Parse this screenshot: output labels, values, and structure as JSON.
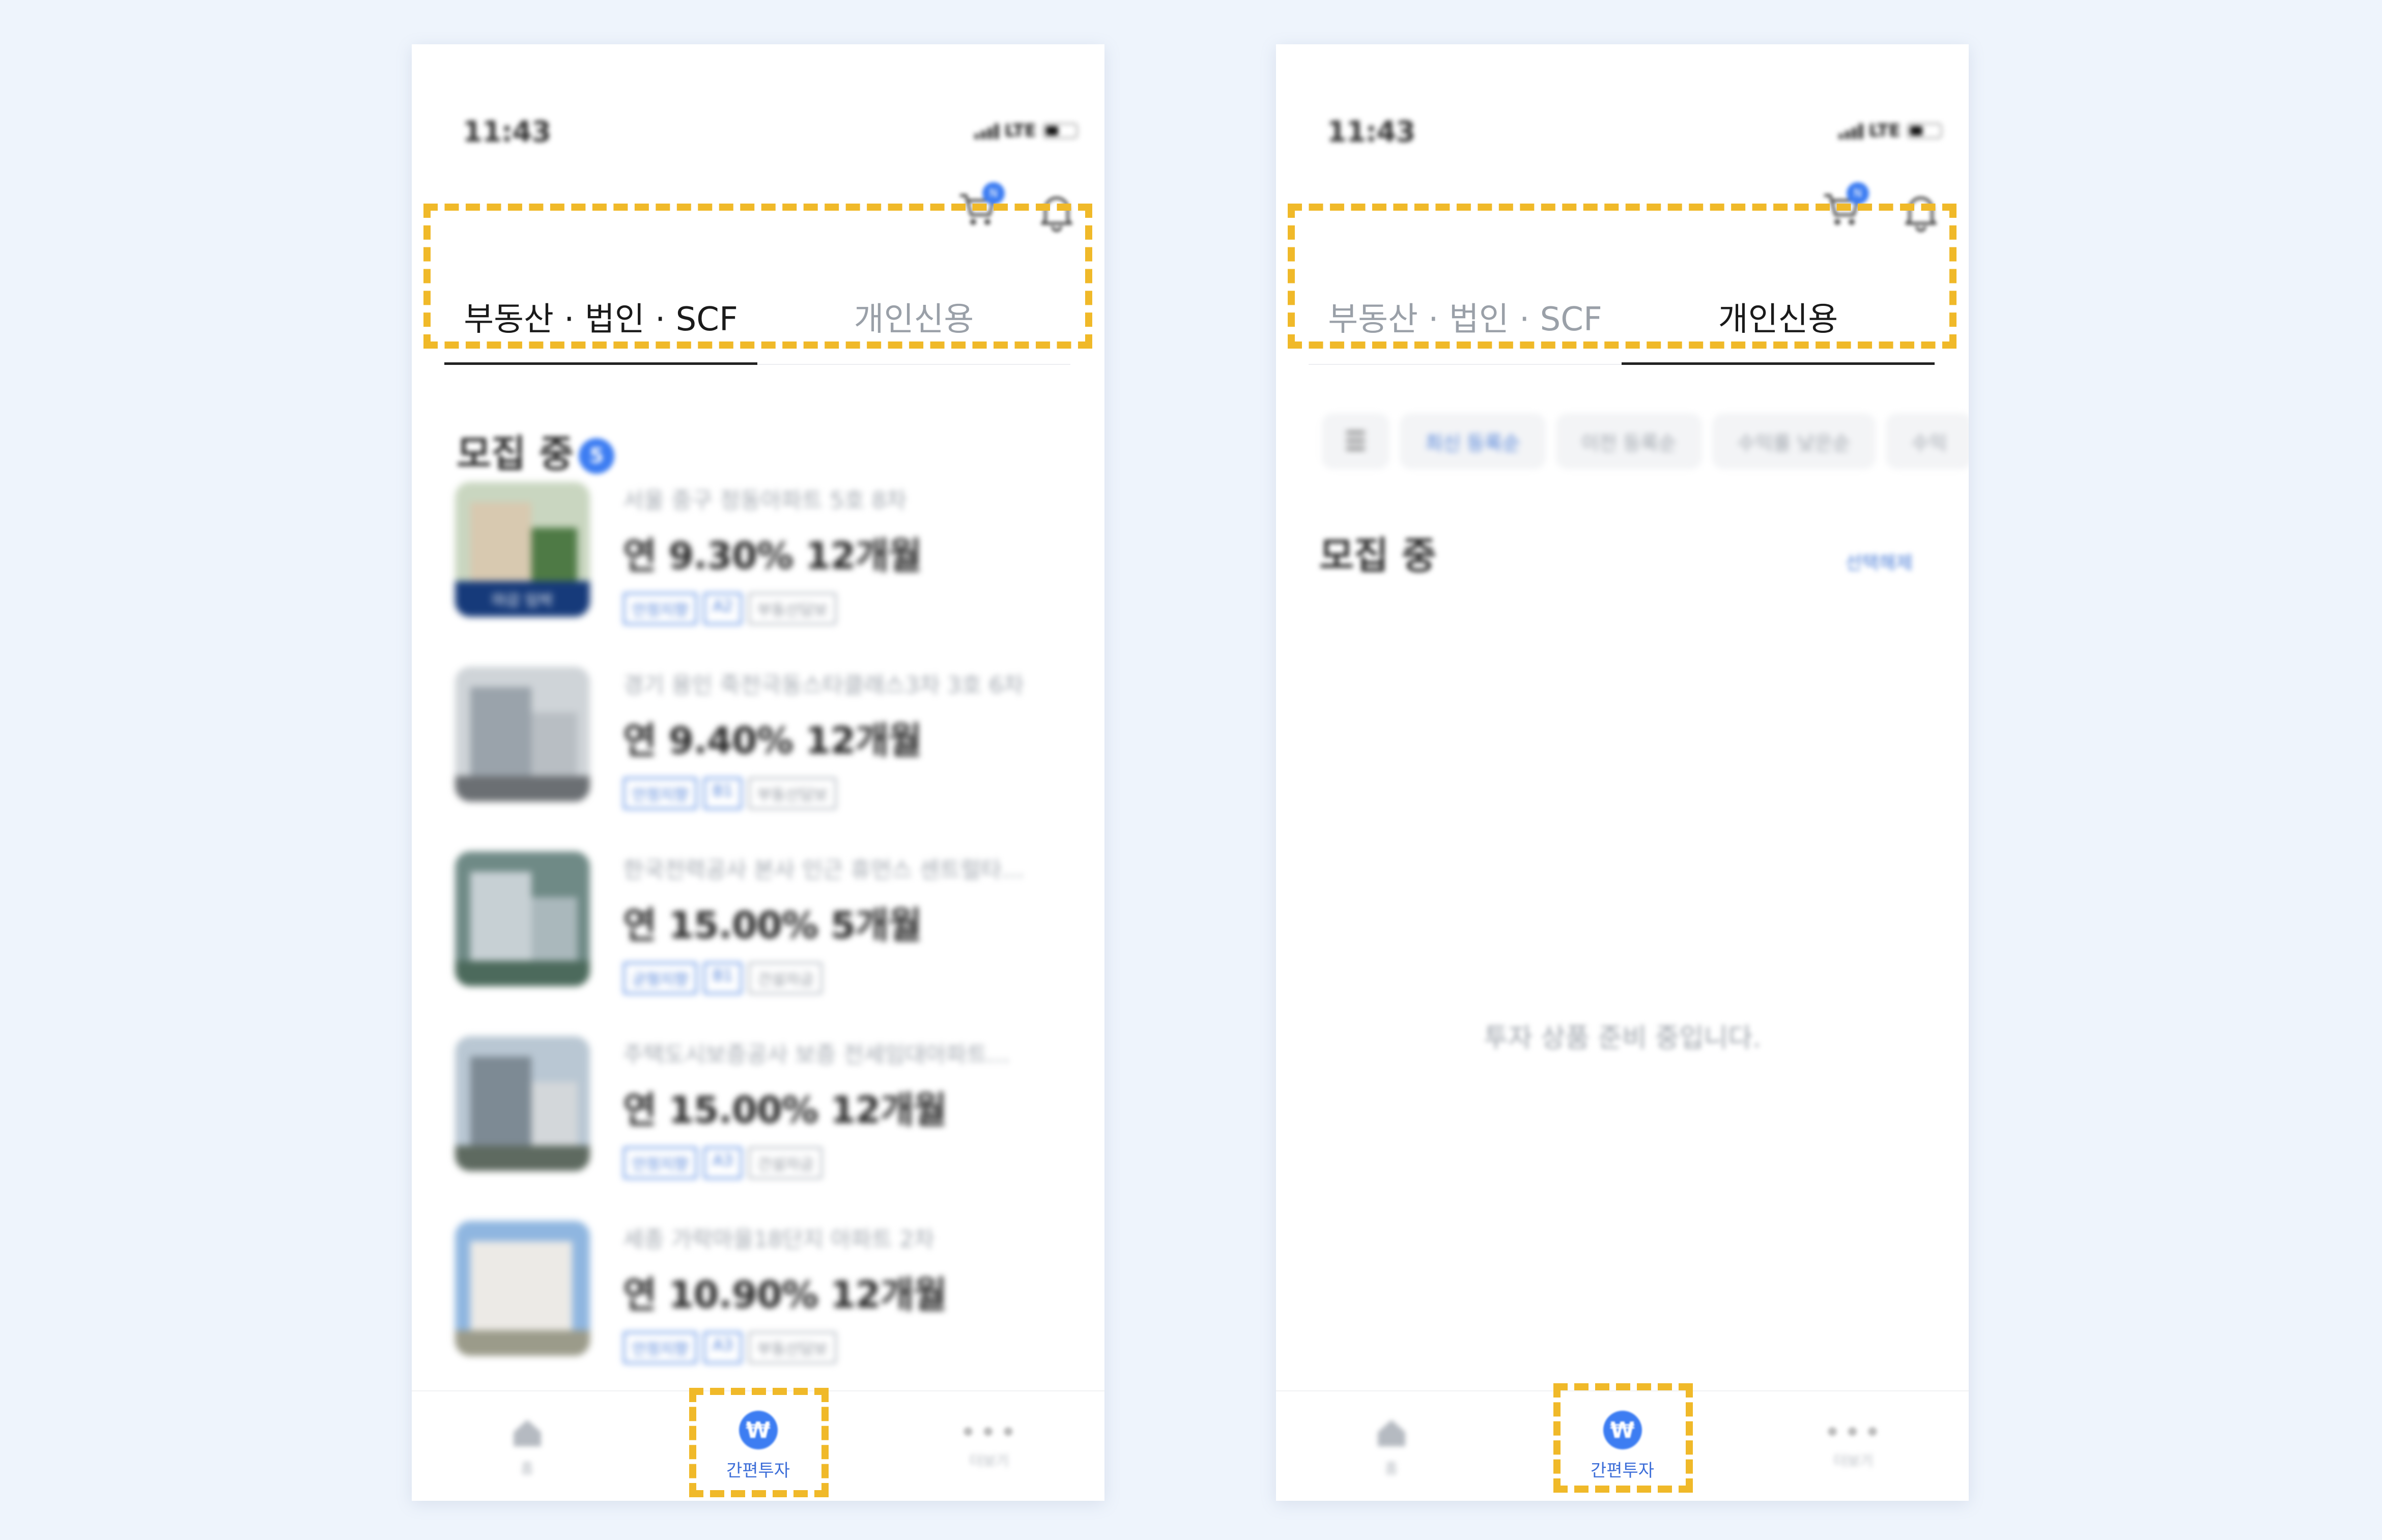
{
  "screens": [
    {
      "status": {
        "time": "11:43",
        "network": "LTE"
      },
      "cart_badge": "N",
      "tabs": [
        "부동산 · 법인 · SCF",
        "개인신용"
      ],
      "active_tab": 0,
      "section": {
        "title": "모집 중",
        "count": "5"
      },
      "products": [
        {
          "name": "서울 중구 정동아파트 5호 8차",
          "rate": "연 9.30% 12개월",
          "tags": [
            "안정지향",
            "A2",
            "부동산담보"
          ],
          "overlay": "마감 임박"
        },
        {
          "name": "경기 용인 죽전극동스타클래스3차 3호 6차",
          "rate": "연 9.40% 12개월",
          "tags": [
            "안정지향",
            "B1",
            "부동산담보"
          ]
        },
        {
          "name": "한국전력공사 본사 인근 휴먼스 센트럴타…",
          "rate": "연 15.00% 5개월",
          "tags": [
            "균형지향",
            "B1",
            "건설자금"
          ]
        },
        {
          "name": "주택도시보증공사 보증 전세임대아파트…",
          "rate": "연 15.00% 12개월",
          "tags": [
            "안정지향",
            "A3",
            "건설자금"
          ]
        },
        {
          "name": "세종 가락마을18단지 아파트 2차",
          "rate": "연 10.90% 12개월",
          "tags": [
            "안정지향",
            "A3",
            "부동산담보"
          ]
        }
      ],
      "nav": {
        "home": "홈",
        "invest": "간편투자",
        "more": "더보기"
      }
    },
    {
      "status": {
        "time": "11:43",
        "network": "LTE"
      },
      "cart_badge": "N",
      "tabs": [
        "부동산 · 법인 · SCF",
        "개인신용"
      ],
      "active_tab": 1,
      "filters": [
        "최신 등록순",
        "이전 등록순",
        "수익률 낮은순",
        "수익"
      ],
      "section": {
        "title": "모집 중",
        "action": "선택해제"
      },
      "empty_message": "투자 상품 준비 중입니다.",
      "nav": {
        "home": "홈",
        "invest": "간편투자",
        "more": "더보기"
      }
    }
  ],
  "colors": {
    "accent": "#3d7df2",
    "highlight": "#f0b929",
    "background": "#eef4fc"
  },
  "icons": [
    "cart-icon",
    "bell-icon",
    "home-icon",
    "won-icon",
    "more-icon",
    "filter-icon"
  ]
}
